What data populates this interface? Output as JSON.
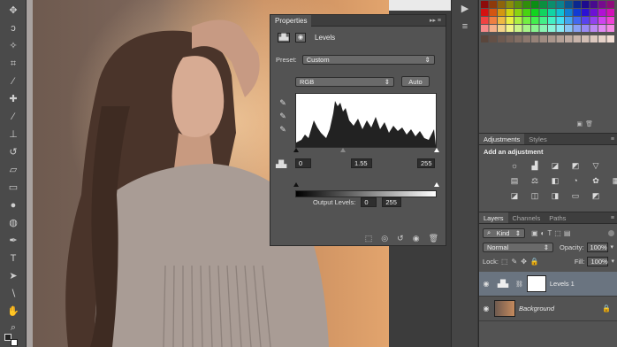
{
  "properties": {
    "panel_title": "Properties",
    "adjustment_title": "Levels",
    "preset_label": "Preset:",
    "preset_value": "Custom",
    "channel_value": "RGB",
    "auto_label": "Auto",
    "input_black": "0",
    "input_gamma": "1.55",
    "input_white": "255",
    "output_levels_label": "Output Levels:",
    "output_black": "0",
    "output_white": "255"
  },
  "adjustments": {
    "tabs": [
      "Adjustments",
      "Styles"
    ],
    "title": "Add an adjustment"
  },
  "layers": {
    "tabs": [
      "Layers",
      "Channels",
      "Paths"
    ],
    "kind_label": "Kind",
    "blend_mode": "Normal",
    "opacity_label": "Opacity:",
    "opacity_value": "100%",
    "lock_label": "Lock:",
    "fill_label": "Fill:",
    "fill_value": "100%",
    "items": [
      {
        "name": "Levels 1"
      },
      {
        "name": "Background"
      }
    ]
  },
  "colors": {
    "panel_bg": "#535353",
    "panel_header": "#3e3e3e",
    "selected_layer": "#6a7480"
  }
}
